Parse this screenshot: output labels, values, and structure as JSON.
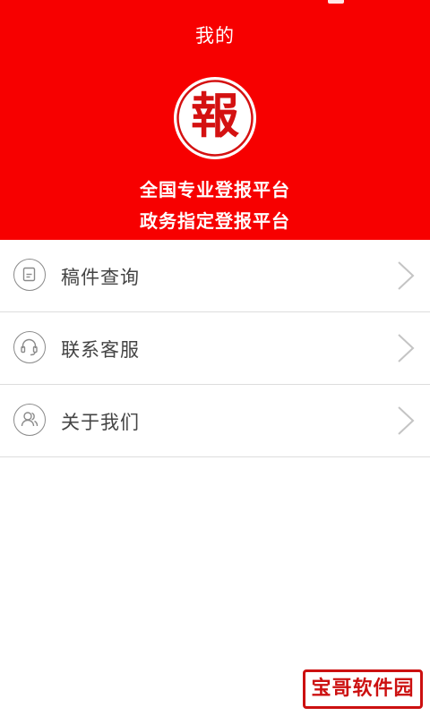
{
  "header": {
    "title": "我的",
    "logo_char": "報",
    "slogan_line1": "全国专业登报平台",
    "slogan_line2": "政务指定登报平台",
    "background_color": "#f70000"
  },
  "menu": {
    "items": [
      {
        "label": "稿件查询",
        "icon": "document-icon"
      },
      {
        "label": "联系客服",
        "icon": "headset-icon"
      },
      {
        "label": "关于我们",
        "icon": "users-icon"
      }
    ]
  },
  "watermark": {
    "text": "宝哥软件园"
  }
}
